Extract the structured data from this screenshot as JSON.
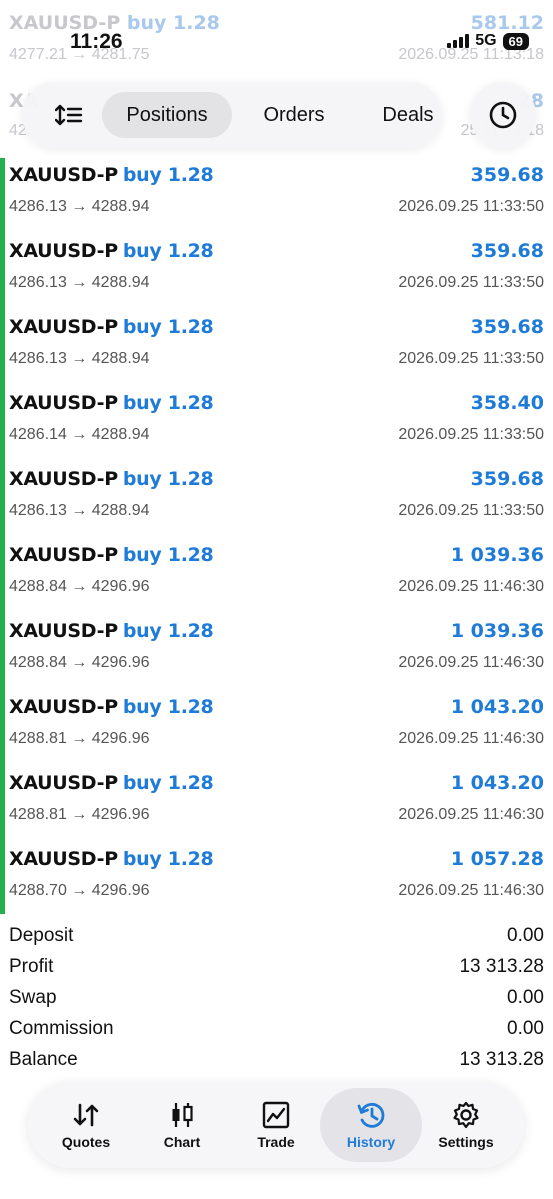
{
  "status_bar": {
    "time": "11:26",
    "network": "5G",
    "battery": "69"
  },
  "ghost_rows": [
    {
      "symbol": "XAUUSD-P",
      "side": "buy 1.28",
      "profit": "581.12",
      "prices": "4277.21 → 4281.75",
      "time": "2026.09.25 11:13:18"
    },
    {
      "symbol": "XA",
      "side": "",
      "profit": "28",
      "prices": "42.",
      "time": "25 11:13:18"
    }
  ],
  "toolbar": {
    "sort_icon": "sort-icon",
    "tabs": [
      {
        "label": "Positions",
        "active": true
      },
      {
        "label": "Orders",
        "active": false
      },
      {
        "label": "Deals",
        "active": false
      }
    ],
    "clock_icon": "clock-icon"
  },
  "deals": [
    {
      "symbol": "XAUUSD-P",
      "side": "buy 1.28",
      "profit": "359.68",
      "prices": "4286.13 → 4288.94",
      "time": "2026.09.25 11:33:50"
    },
    {
      "symbol": "XAUUSD-P",
      "side": "buy 1.28",
      "profit": "359.68",
      "prices": "4286.13 → 4288.94",
      "time": "2026.09.25 11:33:50"
    },
    {
      "symbol": "XAUUSD-P",
      "side": "buy 1.28",
      "profit": "359.68",
      "prices": "4286.13 → 4288.94",
      "time": "2026.09.25 11:33:50"
    },
    {
      "symbol": "XAUUSD-P",
      "side": "buy 1.28",
      "profit": "358.40",
      "prices": "4286.14 → 4288.94",
      "time": "2026.09.25 11:33:50"
    },
    {
      "symbol": "XAUUSD-P",
      "side": "buy 1.28",
      "profit": "359.68",
      "prices": "4286.13 → 4288.94",
      "time": "2026.09.25 11:33:50"
    },
    {
      "symbol": "XAUUSD-P",
      "side": "buy 1.28",
      "profit": "1 039.36",
      "prices": "4288.84 → 4296.96",
      "time": "2026.09.25 11:46:30"
    },
    {
      "symbol": "XAUUSD-P",
      "side": "buy 1.28",
      "profit": "1 039.36",
      "prices": "4288.84 → 4296.96",
      "time": "2026.09.25 11:46:30"
    },
    {
      "symbol": "XAUUSD-P",
      "side": "buy 1.28",
      "profit": "1 043.20",
      "prices": "4288.81 → 4296.96",
      "time": "2026.09.25 11:46:30"
    },
    {
      "symbol": "XAUUSD-P",
      "side": "buy 1.28",
      "profit": "1 043.20",
      "prices": "4288.81 → 4296.96",
      "time": "2026.09.25 11:46:30"
    },
    {
      "symbol": "XAUUSD-P",
      "side": "buy 1.28",
      "profit": "1 057.28",
      "prices": "4288.70 → 4296.96",
      "time": "2026.09.25 11:46:30"
    }
  ],
  "summary": [
    {
      "label": "Deposit",
      "value": "0.00"
    },
    {
      "label": "Profit",
      "value": "13 313.28"
    },
    {
      "label": "Swap",
      "value": "0.00"
    },
    {
      "label": "Commission",
      "value": "0.00"
    },
    {
      "label": "Balance",
      "value": "13 313.28"
    }
  ],
  "bottom_nav": [
    {
      "label": "Quotes",
      "icon": "quotes-icon",
      "active": false
    },
    {
      "label": "Chart",
      "icon": "chart-icon",
      "active": false
    },
    {
      "label": "Trade",
      "icon": "trade-icon",
      "active": false
    },
    {
      "label": "History",
      "icon": "history-icon",
      "active": true
    },
    {
      "label": "Settings",
      "icon": "settings-icon",
      "active": false
    }
  ],
  "colors": {
    "accent": "#1f7bd8",
    "profit_bar": "#22b14c",
    "text": "#111111",
    "muted": "#555555"
  }
}
